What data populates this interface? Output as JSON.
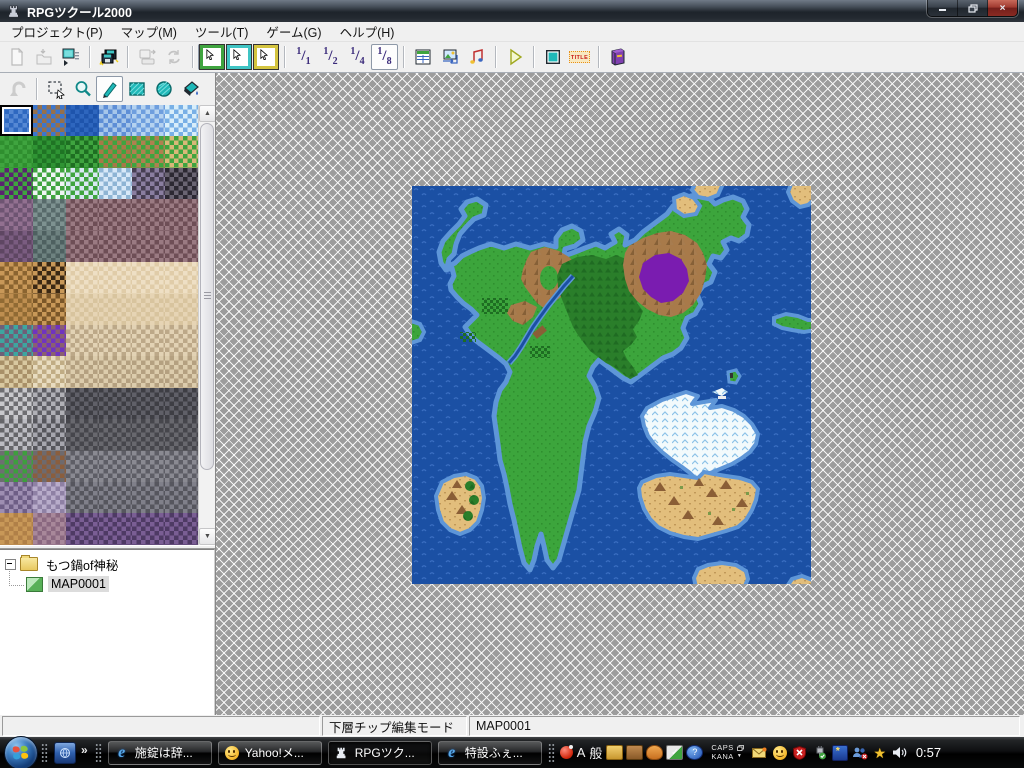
{
  "window": {
    "title": "RPGツクール2000",
    "controls": [
      "minimize",
      "restore",
      "close"
    ]
  },
  "menu": {
    "items": [
      "プロジェクト(P)",
      "マップ(M)",
      "ツール(T)",
      "ゲーム(G)",
      "ヘルプ(H)"
    ]
  },
  "toolbar_main": {
    "buttons": [
      {
        "name": "new-project",
        "icon": "new-page",
        "disabled": true
      },
      {
        "name": "open-project",
        "icon": "open-folder",
        "disabled": true
      },
      {
        "name": "close-project",
        "icon": "close-project"
      },
      {
        "name": "save-all",
        "icon": "save-floppies",
        "sep_before": true
      },
      {
        "name": "create-game-disk",
        "icon": "game-disk",
        "disabled": true,
        "sep_before": true
      },
      {
        "name": "revert-map",
        "icon": "revert-sync",
        "disabled": true
      },
      {
        "name": "lower-layer-mode",
        "icon": "layer-frame",
        "frame": "#3FA43F",
        "pressed": true,
        "sep_before": true
      },
      {
        "name": "upper-layer-mode",
        "icon": "layer-frame",
        "frame": "#3FC4C4"
      },
      {
        "name": "event-layer-mode",
        "icon": "layer-frame",
        "frame": "#D4C43F"
      },
      {
        "name": "zoom-1-1",
        "icon": "fraction",
        "label": "1/1",
        "sep_before": true
      },
      {
        "name": "zoom-1-2",
        "icon": "fraction",
        "label": "1/2"
      },
      {
        "name": "zoom-1-4",
        "icon": "fraction",
        "label": "1/4"
      },
      {
        "name": "zoom-1-8",
        "icon": "fraction",
        "label": "1/8",
        "pressed": true
      },
      {
        "name": "database",
        "icon": "database",
        "sep_before": true
      },
      {
        "name": "resource-manager",
        "icon": "resources"
      },
      {
        "name": "music-test",
        "icon": "music-notes"
      },
      {
        "name": "test-play",
        "icon": "play-triangle",
        "sep_before": true
      },
      {
        "name": "fullscreen-toggle",
        "icon": "teal-screen",
        "sep_before": true
      },
      {
        "name": "show-title",
        "icon": "title-badge",
        "label": "TITLE"
      },
      {
        "name": "help",
        "icon": "help-book",
        "sep_before": true
      }
    ]
  },
  "toolbar_draw": {
    "buttons": [
      {
        "name": "undo",
        "icon": "undo-arrow",
        "disabled": true
      },
      {
        "name": "select-tool",
        "icon": "select-rect",
        "sep_before": true
      },
      {
        "name": "zoom-tool",
        "icon": "magnifier"
      },
      {
        "name": "pen-tool",
        "icon": "pen",
        "pressed": true
      },
      {
        "name": "rectangle-tool",
        "icon": "rect"
      },
      {
        "name": "ellipse-tool",
        "icon": "ellipse"
      },
      {
        "name": "fill-tool",
        "icon": "bucket"
      }
    ]
  },
  "palette": {
    "selected_row": 0,
    "selected_col": 0,
    "rows": [
      [
        [
          "#2E68C0",
          "#5588D4"
        ],
        [
          "#3C76CC",
          "#96704A"
        ],
        [
          "#1E54AC",
          "#2E66BE"
        ],
        [
          "#A6C6EA",
          "#5E8ED6"
        ],
        [
          "#B4D2F0",
          "#6E9EDE"
        ],
        [
          "#D8EEFA",
          "#78B0E6"
        ]
      ],
      [
        [
          "#3FA43F",
          "#2F8F2F"
        ],
        [
          "#2F9434",
          "#1F7424"
        ],
        [
          "#3FA43F",
          "#1E6E22"
        ],
        [
          "#3FA43F",
          "#A87848"
        ],
        [
          "#3FA43F",
          "#B08050"
        ],
        [
          "#3FA43F",
          "#D8B878"
        ]
      ],
      [
        [
          "#3FA43F",
          "#5A2470"
        ],
        [
          "#3FA43F",
          "#EEF4F4"
        ],
        [
          "#3FA43F",
          "#D8E8F4"
        ],
        [
          "#8FB4D4",
          "#D8E8F8"
        ],
        [
          "#463E52",
          "#8A7EA0"
        ],
        [
          "#2C2832",
          "#6A6472"
        ]
      ],
      [
        [
          "#6E5472",
          "#927090"
        ],
        [
          "#586A6A",
          "#7E9290"
        ],
        [
          "#9A7A82",
          "#6E4E56"
        ],
        [
          "#9A7A82",
          "#6E4E56"
        ],
        [
          "#9A7A82",
          "#6E4E56"
        ],
        [
          "#9A7A82",
          "#6E4E56"
        ]
      ],
      [
        [
          "#5E4662",
          "#7A5C80"
        ],
        [
          "#4E6060",
          "#6E8280"
        ],
        [
          "#9A7A82",
          "#6E4E56"
        ],
        [
          "#9A7A82",
          "#6E4E56"
        ],
        [
          "#9A7A82",
          "#6E4E56"
        ],
        [
          "#9A7A82",
          "#6E4E56"
        ]
      ],
      [
        [
          "#C89858",
          "#8A6430"
        ],
        [
          "#C89858",
          "#3A2814"
        ],
        [
          "#EEDFC4",
          "#E0CCA8"
        ],
        [
          "#EEDFC4",
          "#E0CCA8"
        ],
        [
          "#EEDFC4",
          "#E0CCA8"
        ],
        [
          "#EEDFC4",
          "#E0CCA8"
        ]
      ],
      [
        [
          "#BE8E50",
          "#906A34"
        ],
        [
          "#C89858",
          "#7A5628"
        ],
        [
          "#E6D4B4",
          "#D8C49E"
        ],
        [
          "#E6D4B4",
          "#D8C49E"
        ],
        [
          "#E6D4B4",
          "#D8C49E"
        ],
        [
          "#E6D4B4",
          "#D8C49E"
        ]
      ],
      [
        [
          "#6E6078",
          "#3EA6A0"
        ],
        [
          "#8A6070",
          "#7034C0"
        ],
        [
          "#E2D2B4",
          "#BCA888"
        ],
        [
          "#E2D2B4",
          "#BCA888"
        ],
        [
          "#E2D2B4",
          "#BCA888"
        ],
        [
          "#E2D2B4",
          "#BCA888"
        ]
      ],
      [
        [
          "#D8C8A0",
          "#A89068"
        ],
        [
          "#E8DCC0",
          "#C0AC84"
        ],
        [
          "#DCCCAC",
          "#B4A080"
        ],
        [
          "#DCCCAC",
          "#B4A080"
        ],
        [
          "#DCCCAC",
          "#B4A080"
        ],
        [
          "#DCCCAC",
          "#B4A080"
        ]
      ],
      [
        [
          "#6E6E72",
          "#C8C8CC"
        ],
        [
          "#5E5E64",
          "#B0B0B6"
        ],
        [
          "#3E3E44",
          "#606068"
        ],
        [
          "#3E3E44",
          "#606068"
        ],
        [
          "#3E3E44",
          "#606068"
        ],
        [
          "#3E3E44",
          "#606068"
        ]
      ],
      [
        [
          "#66666A",
          "#BCBCC2"
        ],
        [
          "#56565C",
          "#A6A6AE"
        ],
        [
          "#46464C",
          "#68686E"
        ],
        [
          "#46464C",
          "#68686E"
        ],
        [
          "#46464C",
          "#68686E"
        ],
        [
          "#46464C",
          "#68686E"
        ]
      ],
      [
        [
          "#6E6E72",
          "#3E9E3E"
        ],
        [
          "#6E6A6E",
          "#8A5E3E"
        ],
        [
          "#8A8A92",
          "#5E5E66"
        ],
        [
          "#8A8A92",
          "#5E5E66"
        ],
        [
          "#8A8A92",
          "#5E5E66"
        ],
        [
          "#8A8A92",
          "#5E5E66"
        ]
      ],
      [
        [
          "#9E8EB2",
          "#6E5E86"
        ],
        [
          "#8E80A4",
          "#B8ACCA"
        ],
        [
          "#80808A",
          "#56565E"
        ],
        [
          "#80808A",
          "#56565E"
        ],
        [
          "#80808A",
          "#56565E"
        ],
        [
          "#80808A",
          "#56565E"
        ]
      ],
      [
        [
          "#C89858",
          "#B08048"
        ],
        [
          "#A8889A",
          "#8A6880"
        ],
        [
          "#7A5E94",
          "#4E3A64"
        ],
        [
          "#7A5E94",
          "#4E3A64"
        ],
        [
          "#7A5E94",
          "#4E3A64"
        ],
        [
          "#7A5E94",
          "#4E3A64"
        ]
      ]
    ]
  },
  "map_tree": {
    "items": [
      {
        "label": "もつ鍋of神秘",
        "icon": "folder-icon",
        "expander": "minus",
        "indent": 0,
        "selected": false
      },
      {
        "label": "MAP0001",
        "icon": "map-icon",
        "indent": 1,
        "selected": true
      }
    ]
  },
  "statusbar": {
    "left": "",
    "mode": "下層チップ編集モード",
    "map_name": "MAP0001"
  },
  "taskbar": {
    "quick_launch": {
      "chevron": "»"
    },
    "buttons": [
      {
        "label": "施錠は辞...",
        "icon": "ie",
        "active": false
      },
      {
        "label": "Yahoo!メ...",
        "icon": "smiley",
        "active": false
      },
      {
        "label": "RPGツク...",
        "icon": "castle",
        "active": true
      },
      {
        "label": "特設ふぇ...",
        "icon": "ie",
        "active": false
      }
    ],
    "language_bar": {
      "mode_alpha": "A",
      "mode_kanji": "般",
      "caps": "CAPS",
      "kana": "KANA",
      "icons": [
        "tools-basket",
        "toolbox",
        "palette-case",
        "pencil-check",
        "help-circle"
      ]
    },
    "tray": [
      "new-mail",
      "messenger-smiley",
      "security-shield",
      "safely-remove",
      "msn-service",
      "people-offline",
      "favorites-star",
      "volume"
    ],
    "clock": "0:57"
  },
  "map": {
    "name": "MAP0001",
    "zoom": "1/8",
    "edit_mode": "下層チップ編集モード"
  },
  "colors": {
    "map": {
      "ocean": "#1B50A4",
      "wave": "#3A6EC2",
      "shallow": "#5E96D8",
      "grass": "#3CA53C",
      "grass_dot": "#2F8F2F",
      "forest": "#2A7E2A",
      "forest_dark": "#1F6B22",
      "mountain": "#A87A4A",
      "mountain_dark": "#7A5630",
      "crater": "#7A1CB0",
      "ice": "#F2FAFC",
      "ice_line": "#8CC2E8",
      "sand": "#E2BE7C",
      "sand_dark": "#C09858",
      "desert_mtn": "#8A5E36",
      "village": "#1E6E22",
      "bridge": "#8A5E36"
    }
  }
}
